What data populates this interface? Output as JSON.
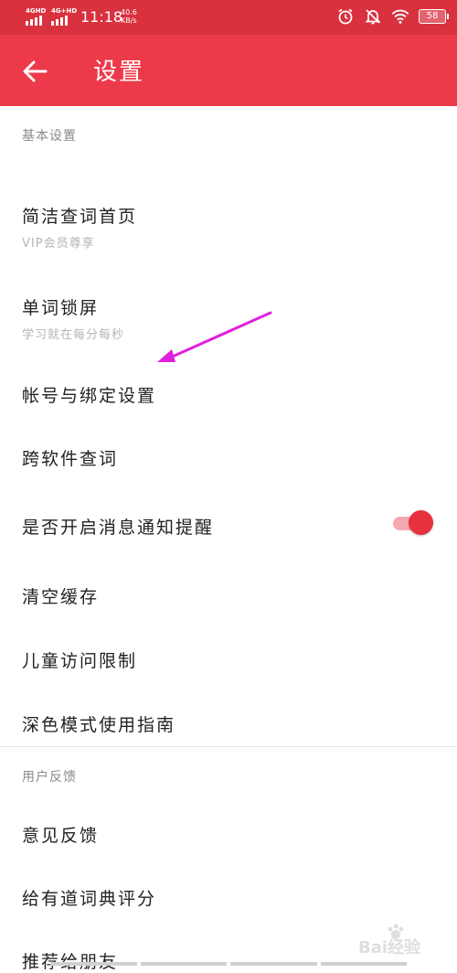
{
  "status_bar": {
    "sim1": "4GHD",
    "sim2": "4G+HD",
    "time": "11:18",
    "speed_value": "40.6",
    "speed_unit": "KB/s",
    "battery": "58",
    "icons": [
      "alarm-icon",
      "bell-off-icon",
      "wifi-icon",
      "battery-icon"
    ]
  },
  "header": {
    "title": "设置",
    "back_icon": "arrow-left-icon"
  },
  "sections": {
    "basic": {
      "title": "基本设置",
      "items": [
        {
          "label": "简洁查词首页",
          "sub": "VIP会员尊享"
        },
        {
          "label": "单词锁屏",
          "sub": "学习就在每分每秒"
        },
        {
          "label": "帐号与绑定设置"
        },
        {
          "label": "跨软件查词"
        },
        {
          "label": "是否开启消息通知提醒",
          "toggle": true
        },
        {
          "label": "清空缓存"
        },
        {
          "label": "儿童访问限制"
        },
        {
          "label": "深色模式使用指南"
        }
      ]
    },
    "feedback": {
      "title": "用户反馈",
      "items": [
        {
          "label": "意见反馈"
        },
        {
          "label": "给有道词典评分"
        },
        {
          "label": "推荐给朋友"
        }
      ]
    }
  },
  "watermark": "Bai经验",
  "colors": {
    "status_bar": "#d9313e",
    "app_bar": "#ed3a4a",
    "toggle_knob": "#e8313e",
    "toggle_track": "#f4a9b0",
    "annotation_arrow": "#e020e0"
  }
}
